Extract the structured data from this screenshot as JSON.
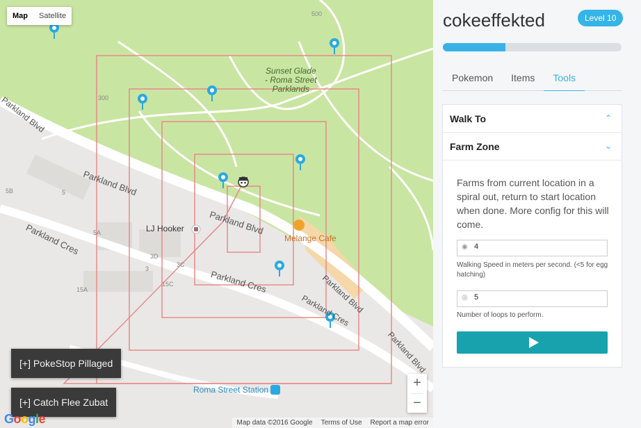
{
  "map": {
    "type_buttons": [
      "Map",
      "Satellite"
    ],
    "park_label": [
      "Sunset Glade",
      "- Roma Street",
      "Parklands"
    ],
    "street_labels": [
      "Parkland Blvd",
      "Parkland Blvd",
      "Parkland Blvd",
      "Parkland Blvd",
      "Parkland Cres",
      "Parkland Cres",
      "Parkland Cres",
      "Parkland Blvd"
    ],
    "poi": {
      "lj_hooker": "LJ Hooker",
      "cafe": "Melange Cafe",
      "station": "Roma Street Station"
    },
    "small_numbers": [
      "500",
      "300",
      "5B",
      "5",
      "5A",
      "3D",
      "3",
      "3C",
      "15C",
      "15A"
    ],
    "zoom_in": "+",
    "zoom_out": "−",
    "google": "Google",
    "attribution": [
      "Map data ©2016 Google",
      "Terms of Use",
      "Report a map error"
    ]
  },
  "toasts": [
    "[+] PokeStop Pillaged",
    "[+] Catch Flee Zubat"
  ],
  "panel": {
    "username": "cokeeffekted",
    "level": "Level 10",
    "xp_progress": 0.35,
    "tabs": [
      "Pokemon",
      "Items",
      "Tools"
    ],
    "active_tab": "Tools",
    "accordion": [
      {
        "title": "Walk To",
        "chevron": "up"
      },
      {
        "title": "Farm Zone",
        "chevron": "down"
      }
    ],
    "farm": {
      "description": "Farms from current location in a spiral out, return to start location when done. More config for this will come.",
      "speed_value": "4",
      "speed_help": "Walking Speed in meters per second. (<5 for egg hatching)",
      "loops_value": "5",
      "loops_help": "Number of loops to perform."
    }
  },
  "colors": {
    "accent": "#38b2e6",
    "play": "#17a2ad",
    "park": "#c8e6a0",
    "spiral": "#e87878"
  }
}
